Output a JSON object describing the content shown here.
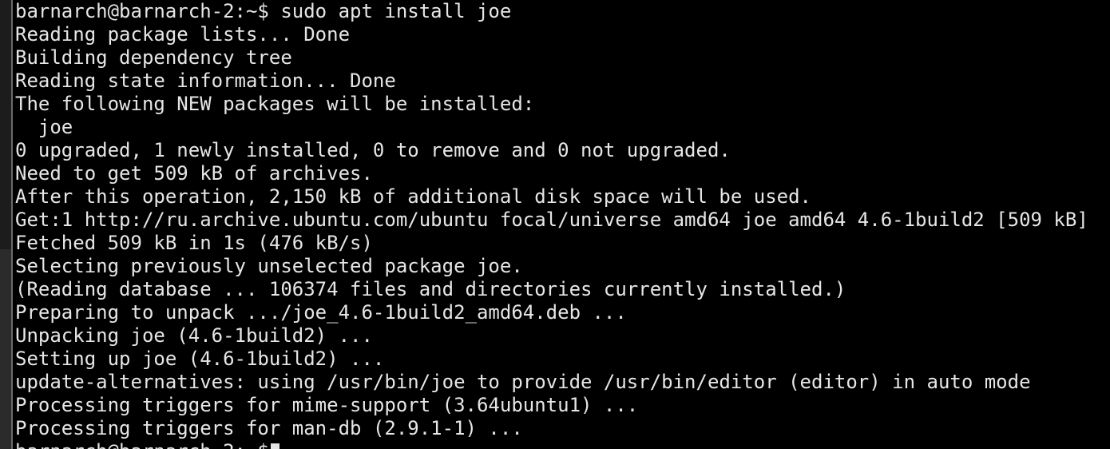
{
  "terminal": {
    "lines": [
      "barnarch@barnarch-2:~$ sudo apt install joe",
      "Reading package lists... Done",
      "Building dependency tree",
      "Reading state information... Done",
      "The following NEW packages will be installed:",
      "  joe",
      "0 upgraded, 1 newly installed, 0 to remove and 0 not upgraded.",
      "Need to get 509 kB of archives.",
      "After this operation, 2,150 kB of additional disk space will be used.",
      "Get:1 http://ru.archive.ubuntu.com/ubuntu focal/universe amd64 joe amd64 4.6-1build2 [509 kB]",
      "Fetched 509 kB in 1s (476 kB/s)",
      "Selecting previously unselected package joe.",
      "(Reading database ... 106374 files and directories currently installed.)",
      "Preparing to unpack .../joe_4.6-1build2_amd64.deb ...",
      "Unpacking joe (4.6-1build2) ...",
      "Setting up joe (4.6-1build2) ...",
      "update-alternatives: using /usr/bin/joe to provide /usr/bin/editor (editor) in auto mode",
      "Processing triggers for mime-support (3.64ubuntu1) ...",
      "Processing triggers for man-db (2.9.1-1) ..."
    ],
    "prompt": "barnarch@barnarch-2:~$"
  },
  "colors": {
    "background": "#000000",
    "foreground": "#e6e6e6"
  }
}
